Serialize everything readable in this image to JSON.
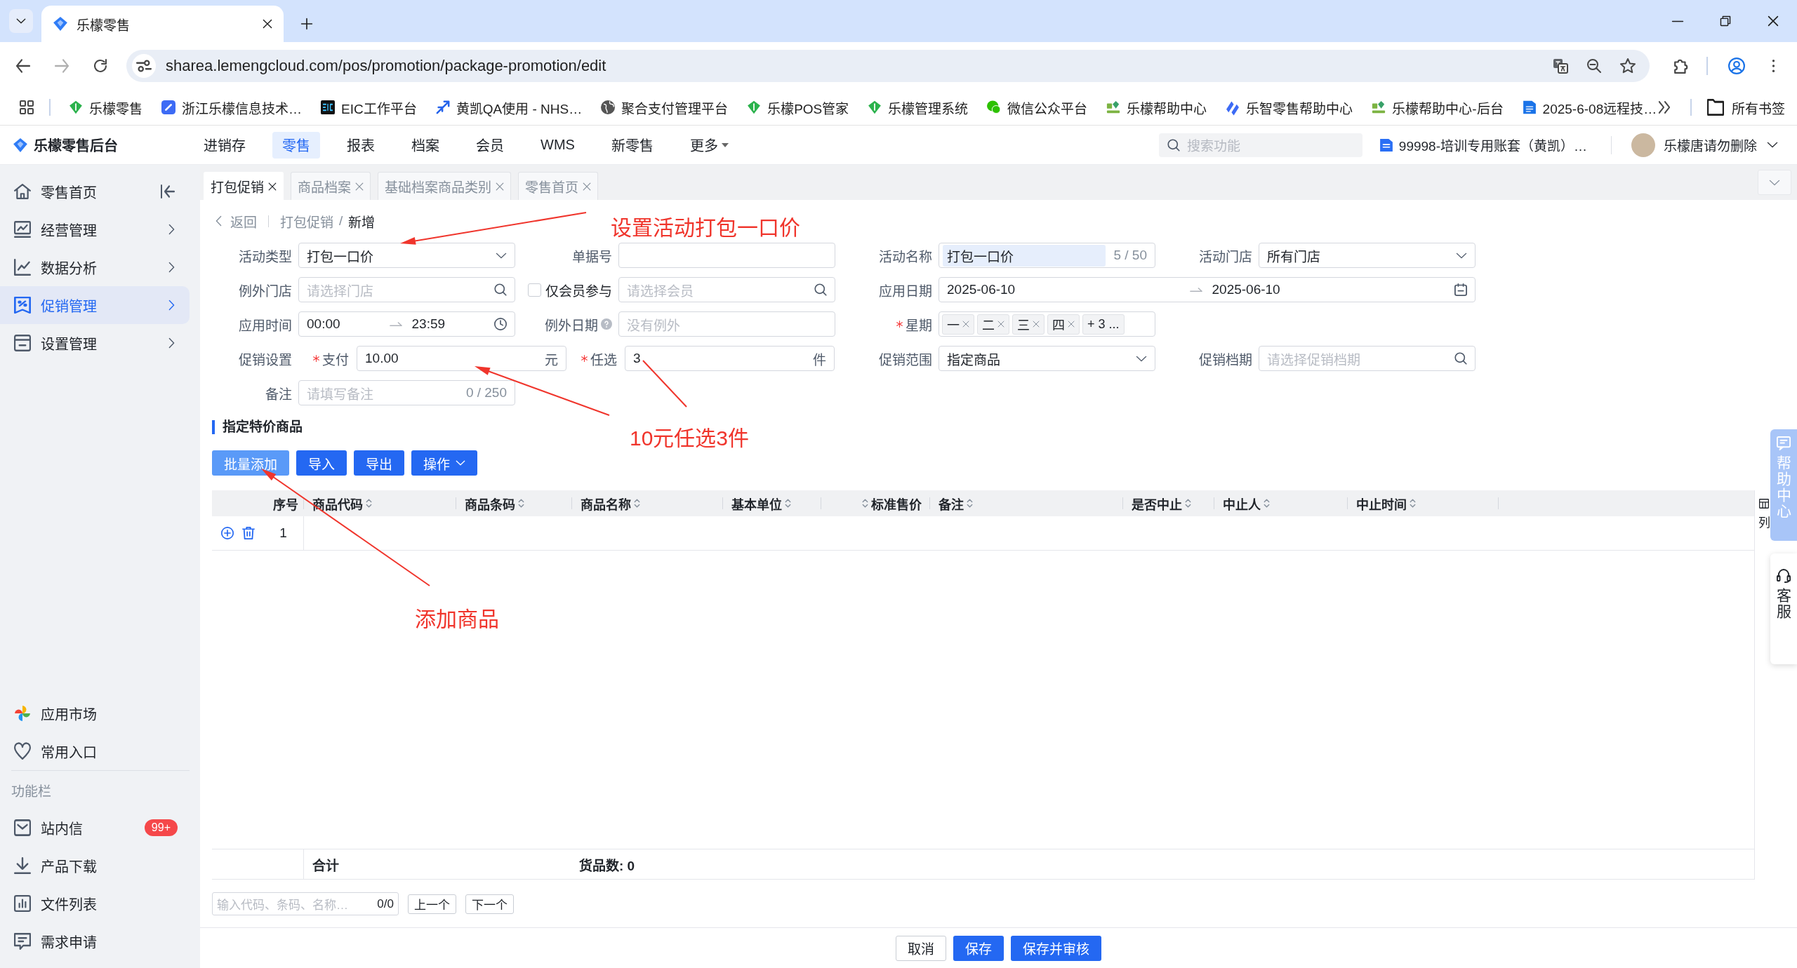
{
  "browser": {
    "tab_title": "乐檬零售",
    "address": "sharea.lemengcloud.com/pos/promotion/package-promotion/edit",
    "bookmarks": [
      {
        "label": "乐檬零售"
      },
      {
        "label": "浙江乐檬信息技术…"
      },
      {
        "label": "EIC工作平台"
      },
      {
        "label": "黄凯QA使用 - NHS…"
      },
      {
        "label": "聚合支付管理平台"
      },
      {
        "label": "乐檬POS管家"
      },
      {
        "label": "乐檬管理系统"
      },
      {
        "label": "微信公众平台"
      },
      {
        "label": "乐檬帮助中心"
      },
      {
        "label": "乐智零售帮助中心"
      },
      {
        "label": "乐檬帮助中心-后台"
      },
      {
        "label": "2025-6-08远程技…"
      }
    ],
    "all_bookmarks": "所有书签"
  },
  "app_header": {
    "title": "乐檬零售后台",
    "nav": [
      {
        "label": "进销存",
        "selected": false,
        "dropdown": false
      },
      {
        "label": "零售",
        "selected": true,
        "dropdown": false
      },
      {
        "label": "报表",
        "selected": false,
        "dropdown": false
      },
      {
        "label": "档案",
        "selected": false,
        "dropdown": false
      },
      {
        "label": "会员",
        "selected": false,
        "dropdown": false
      },
      {
        "label": "WMS",
        "selected": false,
        "dropdown": false
      },
      {
        "label": "新零售",
        "selected": false,
        "dropdown": false
      },
      {
        "label": "更多",
        "selected": false,
        "dropdown": true
      }
    ],
    "search": {
      "placeholder": "搜索功能"
    },
    "account": "99998-培训专用账套（黄凯）…",
    "user": "乐檬唐请勿删除"
  },
  "sidebar": {
    "menu": [
      {
        "label": "零售首页",
        "selected": false,
        "expandable": false
      },
      {
        "label": "经营管理",
        "selected": false,
        "expandable": true
      },
      {
        "label": "数据分析",
        "selected": false,
        "expandable": true
      },
      {
        "label": "促销管理",
        "selected": true,
        "expandable": true
      },
      {
        "label": "设置管理",
        "selected": false,
        "expandable": true
      }
    ],
    "shortcuts": [
      {
        "label": "应用市场"
      },
      {
        "label": "常用入口"
      }
    ],
    "section_title": "功能栏",
    "tools": [
      {
        "label": "站内信",
        "badge": "99+"
      },
      {
        "label": "产品下载"
      },
      {
        "label": "文件列表"
      },
      {
        "label": "需求申请"
      }
    ]
  },
  "page_tabs": [
    {
      "label": "打包促销",
      "selected": true
    },
    {
      "label": "商品档案",
      "selected": false
    },
    {
      "label": "基础档案商品类别",
      "selected": false
    },
    {
      "label": "零售首页",
      "selected": false
    }
  ],
  "breadcrumb": {
    "back": "返回",
    "path": [
      {
        "label": "打包促销"
      },
      {
        "label": "新增"
      }
    ],
    "separator": "/"
  },
  "form": {
    "rows": [
      {
        "fields": [
          {
            "kind": "select",
            "label": "活动类型",
            "required": false,
            "value": "打包一口价"
          },
          {
            "kind": "text",
            "label": "单据号",
            "required": false
          },
          {
            "kind": "counted",
            "label": "活动名称",
            "required": false,
            "value": "打包一口价",
            "highlighted": true,
            "count": "5 / 50"
          },
          {
            "kind": "select",
            "label": "活动门店",
            "required": false,
            "value": "所有门店"
          }
        ]
      },
      {
        "fields": [
          {
            "kind": "search",
            "label": "例外门店",
            "required": false,
            "placeholder": "请选择门店"
          },
          {
            "kind": "checkbox_search",
            "label": "仅会员参与",
            "checked": false,
            "placeholder": "请选择会员"
          },
          {
            "kind": "date_range",
            "label": "应用日期",
            "required": false,
            "start": "2025-06-10",
            "end": "2025-06-10"
          }
        ]
      },
      {
        "fields": [
          {
            "kind": "time_range",
            "label": "应用时间",
            "required": false,
            "start": "00:00",
            "end": "23:59"
          },
          {
            "kind": "text",
            "label": "例外日期",
            "required": false,
            "help": true,
            "placeholder": "没有例外"
          },
          {
            "kind": "tags",
            "label": "星期",
            "required": true,
            "tags": [
              "一",
              "二",
              "三",
              "四"
            ],
            "more": "+ 3 ..."
          }
        ]
      },
      {
        "fields": [
          {
            "kind": "amounts",
            "label": "促销设置",
            "required": false,
            "items": [
              {
                "label": "支付",
                "required": true,
                "value": "10.00",
                "suffix": "元"
              },
              {
                "label": "任选",
                "required": true,
                "value": "3",
                "suffix": "件"
              }
            ]
          },
          {
            "kind": "select",
            "label": "促销范围",
            "required": false,
            "value": "指定商品"
          },
          {
            "kind": "search",
            "label": "促销档期",
            "required": false,
            "placeholder": "请选择促销档期"
          }
        ]
      },
      {
        "fields": [
          {
            "kind": "counted",
            "label": "备注",
            "required": false,
            "placeholder": "请填写备注",
            "count": "0 / 250"
          }
        ]
      }
    ]
  },
  "section": {
    "title": "指定特价商品"
  },
  "toolbar": [
    {
      "label": "批量添加",
      "hovered": true,
      "dropdown": false
    },
    {
      "label": "导入",
      "hovered": false,
      "dropdown": false
    },
    {
      "label": "导出",
      "hovered": false,
      "dropdown": false
    },
    {
      "label": "操作",
      "hovered": false,
      "dropdown": true
    }
  ],
  "table": {
    "columns": [
      {
        "label": "序号",
        "kind": "index",
        "sortable": false
      },
      {
        "label": "商品代码",
        "kind": "text",
        "sortable": true
      },
      {
        "label": "商品条码",
        "kind": "text",
        "sortable": true
      },
      {
        "label": "商品名称",
        "kind": "text",
        "sortable": true
      },
      {
        "label": "基本单位",
        "kind": "text",
        "sortable": true
      },
      {
        "label": "标准售价",
        "kind": "number",
        "sortable": true
      },
      {
        "label": "备注",
        "kind": "text",
        "sortable": true
      },
      {
        "label": "是否中止",
        "kind": "text",
        "sortable": true
      },
      {
        "label": "中止人",
        "kind": "text",
        "sortable": true
      },
      {
        "label": "中止时间",
        "kind": "text",
        "sortable": true
      }
    ],
    "rows": [
      {
        "index": "1"
      }
    ],
    "summary": {
      "label": "合计",
      "count": "货品数: 0"
    },
    "column_setting": "列"
  },
  "finder": {
    "placeholder": "输入代码、条码、名称…",
    "count": "0/0",
    "buttons": [
      "上一个",
      "下一个"
    ]
  },
  "actions": [
    {
      "label": "取消",
      "primary": false
    },
    {
      "label": "保存",
      "primary": true
    },
    {
      "label": "保存并审核",
      "primary": true
    }
  ],
  "side_widgets": [
    {
      "label": "帮助中心"
    },
    {
      "label": "客服"
    }
  ],
  "annotations": [
    {
      "text": "设置活动打包一口价"
    },
    {
      "text": "10元任选3件"
    },
    {
      "text": "添加商品"
    }
  ]
}
